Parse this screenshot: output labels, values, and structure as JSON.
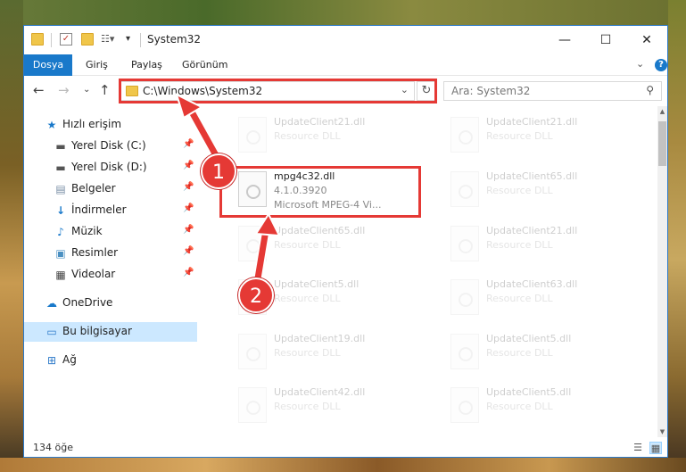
{
  "window": {
    "title": "System32"
  },
  "menu": {
    "file": "Dosya",
    "home": "Giriş",
    "share": "Paylaş",
    "view": "Görünüm"
  },
  "address": {
    "path": "C:\\Windows\\System32",
    "search_placeholder": "Ara: System32"
  },
  "nav": {
    "quick_access": "Hızlı erişim",
    "items": [
      "Yerel Disk (C:)",
      "Yerel Disk (D:)",
      "Belgeler",
      "İndirmeler",
      "Müzik",
      "Resimler",
      "Videolar"
    ],
    "onedrive": "OneDrive",
    "this_pc": "Bu bilgisayar",
    "network": "Ağ"
  },
  "files": {
    "highlighted": {
      "name": "mpg4c32.dll",
      "version": "4.1.0.3920",
      "description": "Microsoft MPEG-4 Vi..."
    },
    "left": [
      {
        "name": "UpdateClient21.dll",
        "type": "Resource DLL"
      },
      {
        "name": "UpdateClient65.dll",
        "type": "Resource DLL"
      },
      {
        "name": "UpdateClient5.dll",
        "type": "Resource DLL"
      },
      {
        "name": "UpdateClient19.dll",
        "type": "Resource DLL"
      },
      {
        "name": "UpdateClient42.dll",
        "type": "Resource DLL"
      }
    ],
    "right": [
      {
        "name": "UpdateClient21.dll",
        "type": "Resource DLL"
      },
      {
        "name": "UpdateClient65.dll",
        "type": "Resource DLL"
      },
      {
        "name": "UpdateClient21.dll",
        "type": "Resource DLL"
      },
      {
        "name": "UpdateClient63.dll",
        "type": "Resource DLL"
      },
      {
        "name": "UpdateClient5.dll",
        "type": "Resource DLL"
      },
      {
        "name": "UpdateClient5.dll",
        "type": "Resource DLL"
      }
    ]
  },
  "status": {
    "count": "134 öğe"
  },
  "annotations": {
    "step1": "1",
    "step2": "2"
  },
  "colors": {
    "accent": "#1979ca",
    "highlight": "#e53935",
    "selected": "#cce8ff"
  }
}
